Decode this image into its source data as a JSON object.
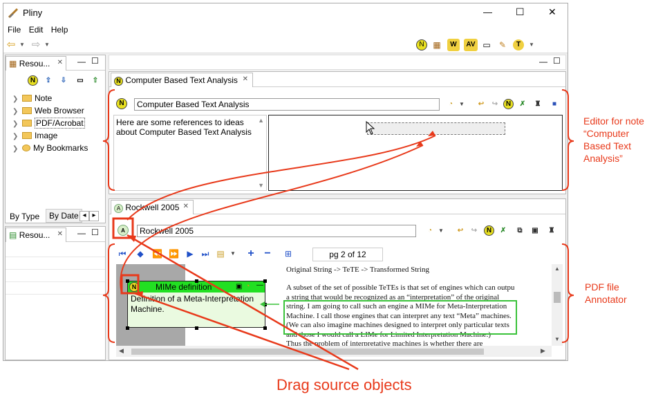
{
  "window": {
    "title": "Pliny",
    "controls": [
      "—",
      "☐",
      "✕"
    ]
  },
  "menu": {
    "items": [
      "File",
      "Edit",
      "Help"
    ]
  },
  "toolbar": {
    "nav_back": "⇦",
    "nav_fwd": "⇨",
    "right_icons": [
      "N",
      "▦",
      "W",
      "AV",
      "▭",
      "✎",
      "T"
    ]
  },
  "resources_panel": {
    "tab_label": "Resou...",
    "close": "✕",
    "tree": [
      {
        "label": "Note"
      },
      {
        "label": "Web Browser"
      },
      {
        "label": "PDF/Acrobat",
        "selected": true
      },
      {
        "label": "Image"
      },
      {
        "label": "My Bookmarks"
      }
    ],
    "bottom_tabs": [
      "By Type",
      "By Date"
    ],
    "nav_prev": "◂",
    "nav_next": "▸"
  },
  "resources_panel2": {
    "tab_label": "Resou...",
    "close": "✕"
  },
  "note_editor": {
    "tab_label": "Computer Based Text Analysis",
    "close": "✕",
    "title_value": "Computer Based Text Analysis",
    "body_text_line1": "Here are some references to ideas",
    "body_text_line2": "about Computer Based Text Analysis"
  },
  "pdf_editor": {
    "tab_label": "Rockwell 2005",
    "close": "✕",
    "title_value": "Rockwell 2005",
    "page_indicator": "pg 2 of 12",
    "note_popup": {
      "title": "MIMe definition",
      "body_line1": "Definition of a Meta-Interpretation",
      "body_line2": "Machine."
    },
    "pdf_lines": [
      "Original String -> TeTE -> Transformed String",
      "",
      "A subset of the set of possible TeTEs is that set of engines which can output",
      "a string that would be recognized as an “interpretation” of the original",
      "string. I am going to call such an engine a MIMe for Meta-Interpretation",
      "Machine. I call those engines that can interpret any text “Meta” machines.",
      "(We can also imagine machines designed to interpret only particular texts",
      "and those I would call a LIMe for Limited Interpretation Machine.)",
      "            Thus the problem of interpretative machines is whether there are"
    ]
  },
  "annotations": {
    "editor_label_lines": [
      "Editor for note",
      "“Computer",
      "Based Text",
      "Analysis”"
    ],
    "pdf_label_lines": [
      "PDF file",
      "Annotator"
    ],
    "drag_label": "Drag source objects"
  },
  "colors": {
    "annotation_red": "#e8391a",
    "note_green": "#22e022",
    "highlight_green": "#39c239",
    "n_icon_yellow": "#e8e020"
  }
}
